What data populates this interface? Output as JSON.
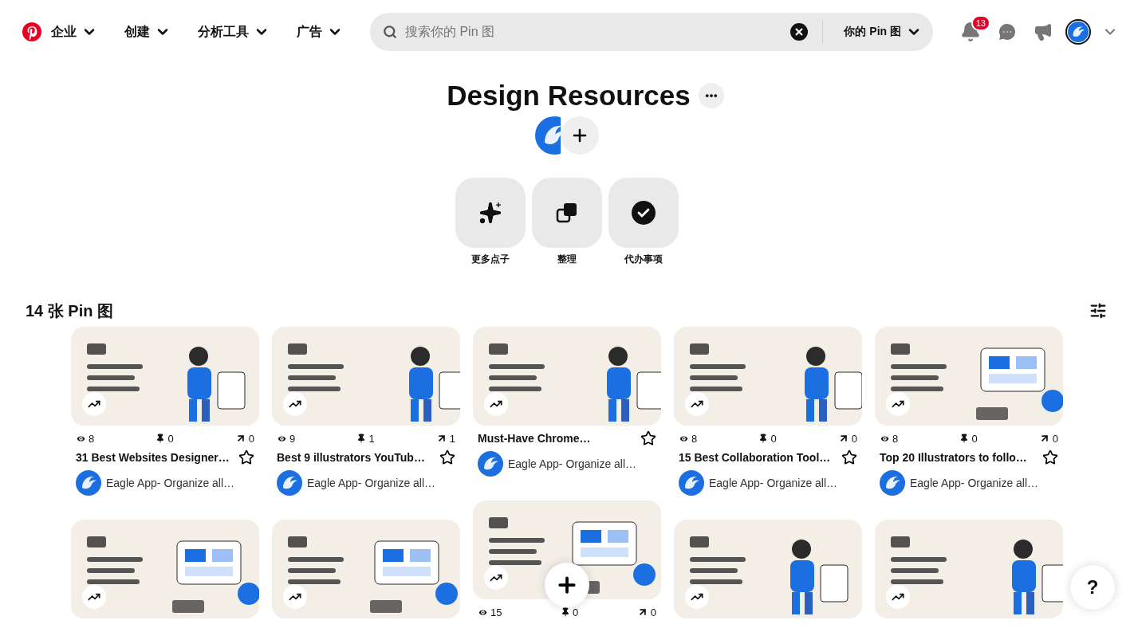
{
  "header": {
    "nav": [
      {
        "label": "企业"
      },
      {
        "label": "创建"
      },
      {
        "label": "分析工具"
      },
      {
        "label": "广告"
      }
    ],
    "search": {
      "placeholder": "搜索你的 Pin 图",
      "scope": "你的 Pin 图"
    },
    "notifications": {
      "badge": "13"
    }
  },
  "board": {
    "title": "Design Resources",
    "actions": [
      {
        "kind": "ideas",
        "label": "更多点子"
      },
      {
        "kind": "organize",
        "label": "整理"
      },
      {
        "kind": "todo",
        "label": "代办事项"
      }
    ],
    "pin_count": "14 张 Pin 图"
  },
  "columns": [
    {
      "pins": [
        {
          "image": {
            "kind": "picture"
          },
          "stats": {
            "views": "8",
            "saves": "0",
            "clicks": "0"
          },
          "title": "31 Best Websites Designer…",
          "author": "Eagle App- Organize all…"
        },
        {
          "image": {
            "kind": "picture"
          }
        }
      ]
    },
    {
      "pins": [
        {
          "image": {
            "kind": "picture"
          },
          "stats": {
            "views": "9",
            "saves": "1",
            "clicks": "1"
          },
          "title": "Best 9 illustrators YouTub…",
          "author": "Eagle App- Organize all…"
        },
        {
          "image": {
            "kind": "picture"
          }
        }
      ]
    },
    {
      "pins": [
        {
          "image": {
            "kind": "picture"
          },
          "title": "Must-Have Chrome…",
          "author": "Eagle App- Organize all…"
        },
        {
          "image": {
            "kind": "picture"
          },
          "stats": {
            "views": "15",
            "saves": "0",
            "clicks": "0"
          }
        }
      ]
    },
    {
      "pins": [
        {
          "image": {
            "kind": "picture"
          },
          "stats": {
            "views": "8",
            "saves": "0",
            "clicks": "0"
          },
          "title": "15 Best Collaboration Tool…",
          "author": "Eagle App- Organize all…"
        },
        {
          "image": {
            "kind": "picture"
          }
        }
      ]
    },
    {
      "pins": [
        {
          "image": {
            "kind": "picture"
          },
          "stats": {
            "views": "8",
            "saves": "0",
            "clicks": "0"
          },
          "title": "Top 20 Illustrators to follo…",
          "author": "Eagle App- Organize all…"
        },
        {
          "image": {
            "kind": "picture"
          }
        }
      ]
    }
  ],
  "help": {
    "label": "?"
  }
}
